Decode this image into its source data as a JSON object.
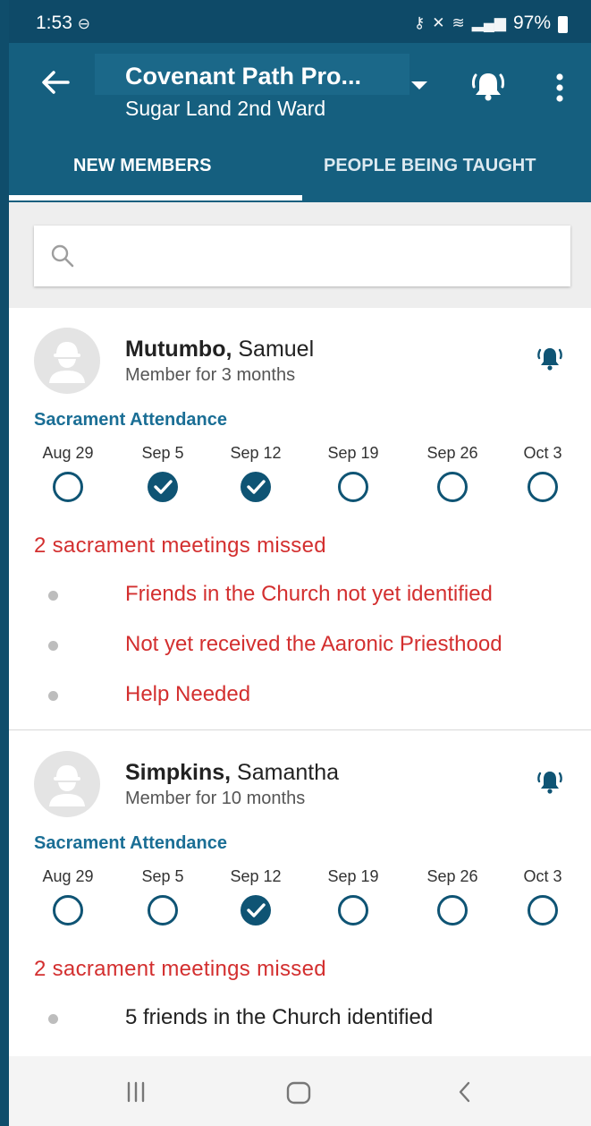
{
  "status_bar": {
    "time": "1:53",
    "battery": "97%"
  },
  "header": {
    "title": "Covenant Path Pro...",
    "subtitle": "Sugar Land 2nd Ward"
  },
  "tabs": [
    {
      "label": "NEW MEMBERS",
      "selected": true
    },
    {
      "label": "PEOPLE BEING TAUGHT",
      "selected": false
    }
  ],
  "search": {
    "placeholder": "",
    "value": ""
  },
  "attendance_label": "Sacrament Attendance",
  "members": [
    {
      "last_name": "Mutumbo,",
      "first_name": "Samuel",
      "member_for": "Member for 3 months",
      "weeks": [
        {
          "date": "Aug 29",
          "attended": false
        },
        {
          "date": "Sep 5",
          "attended": true
        },
        {
          "date": "Sep 12",
          "attended": true
        },
        {
          "date": "Sep 19",
          "attended": false
        },
        {
          "date": "Sep 26",
          "attended": false
        },
        {
          "date": "Oct 3",
          "attended": false
        }
      ],
      "missed": "2 sacrament meetings missed",
      "flags": [
        {
          "text": "Friends in the Church not yet identified",
          "alert": true
        },
        {
          "text": "Not yet received the Aaronic Priesthood",
          "alert": true
        },
        {
          "text": "Help Needed",
          "alert": true
        }
      ]
    },
    {
      "last_name": "Simpkins,",
      "first_name": "Samantha",
      "member_for": "Member for 10 months",
      "weeks": [
        {
          "date": "Aug 29",
          "attended": false
        },
        {
          "date": "Sep 5",
          "attended": false
        },
        {
          "date": "Sep 12",
          "attended": true
        },
        {
          "date": "Sep 19",
          "attended": false
        },
        {
          "date": "Sep 26",
          "attended": false
        },
        {
          "date": "Oct 3",
          "attended": false
        }
      ],
      "missed": "2 sacrament meetings missed",
      "flags": [
        {
          "text": "5 friends in the Church identified",
          "alert": false
        }
      ]
    }
  ],
  "colors": {
    "primary": "#155f7f",
    "status_bar": "#0e4a68",
    "accent": "#1a6e95",
    "alert": "#d32f2f",
    "check_fill": "#0f5474"
  },
  "icons": {
    "back": "arrow-left-icon",
    "dropdown": "caret-down-icon",
    "notifications": "bell-ringing-icon",
    "more": "more-vertical-icon",
    "search": "search-icon",
    "avatar": "person-placeholder-icon",
    "attended": "check-circle-filled-icon",
    "not_attended": "circle-outline-icon",
    "nav_recents": "recents-icon",
    "nav_home": "home-icon",
    "nav_back": "back-chevron-icon"
  }
}
